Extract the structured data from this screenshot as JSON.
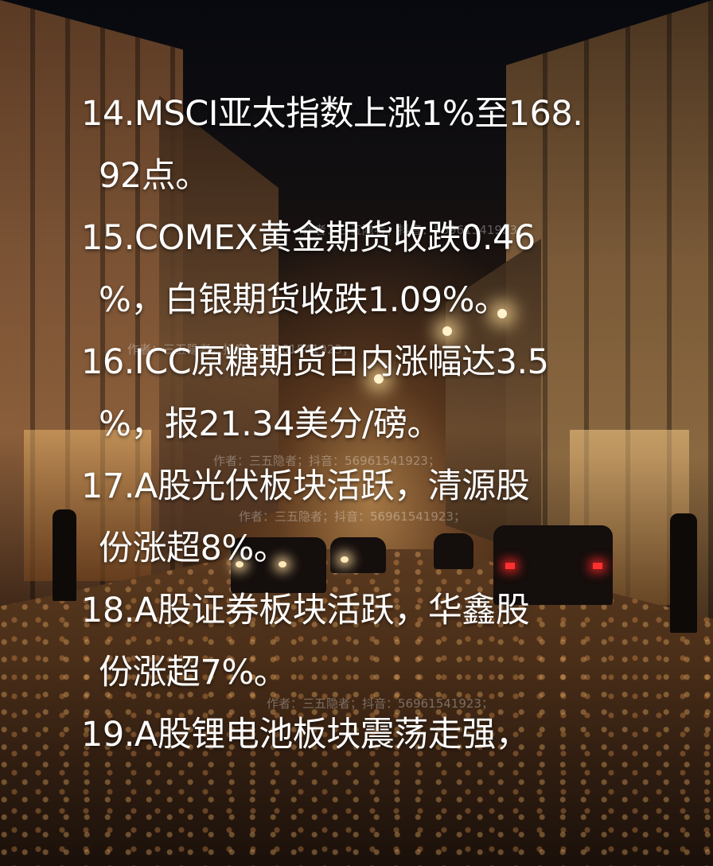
{
  "news_lines": [
    {
      "text": "14.MSCI亚太指数上涨1%至168.",
      "indent": false
    },
    {
      "text": "92点。",
      "indent": true
    },
    {
      "text": "15.COMEX黄金期货收跌0.46",
      "indent": false
    },
    {
      "text": "%，白银期货收跌1.09%。",
      "indent": true
    },
    {
      "text": "16.ICC原糖期货日内涨幅达3.5",
      "indent": false
    },
    {
      "text": "%，报21.34美分/磅。",
      "indent": true
    },
    {
      "text": "17.A股光伏板块活跃，清源股",
      "indent": false
    },
    {
      "text": "份涨超8%。",
      "indent": true
    },
    {
      "text": "18.A股证券板块活跃，华鑫股",
      "indent": false
    },
    {
      "text": "份涨超7%。",
      "indent": true
    },
    {
      "text": "19.A股锂电池板块震荡走强，",
      "indent": false
    }
  ],
  "watermarks": [
    "作者：三五隐者；抖音：56961541923；",
    "作者：三五隐者；抖音：56961541923；",
    "作者：三五隐者；抖音：56961541923；",
    "作者：三五隐者；抖音：56961541923；",
    "作者：三五隐者；抖音：56961541923；"
  ]
}
